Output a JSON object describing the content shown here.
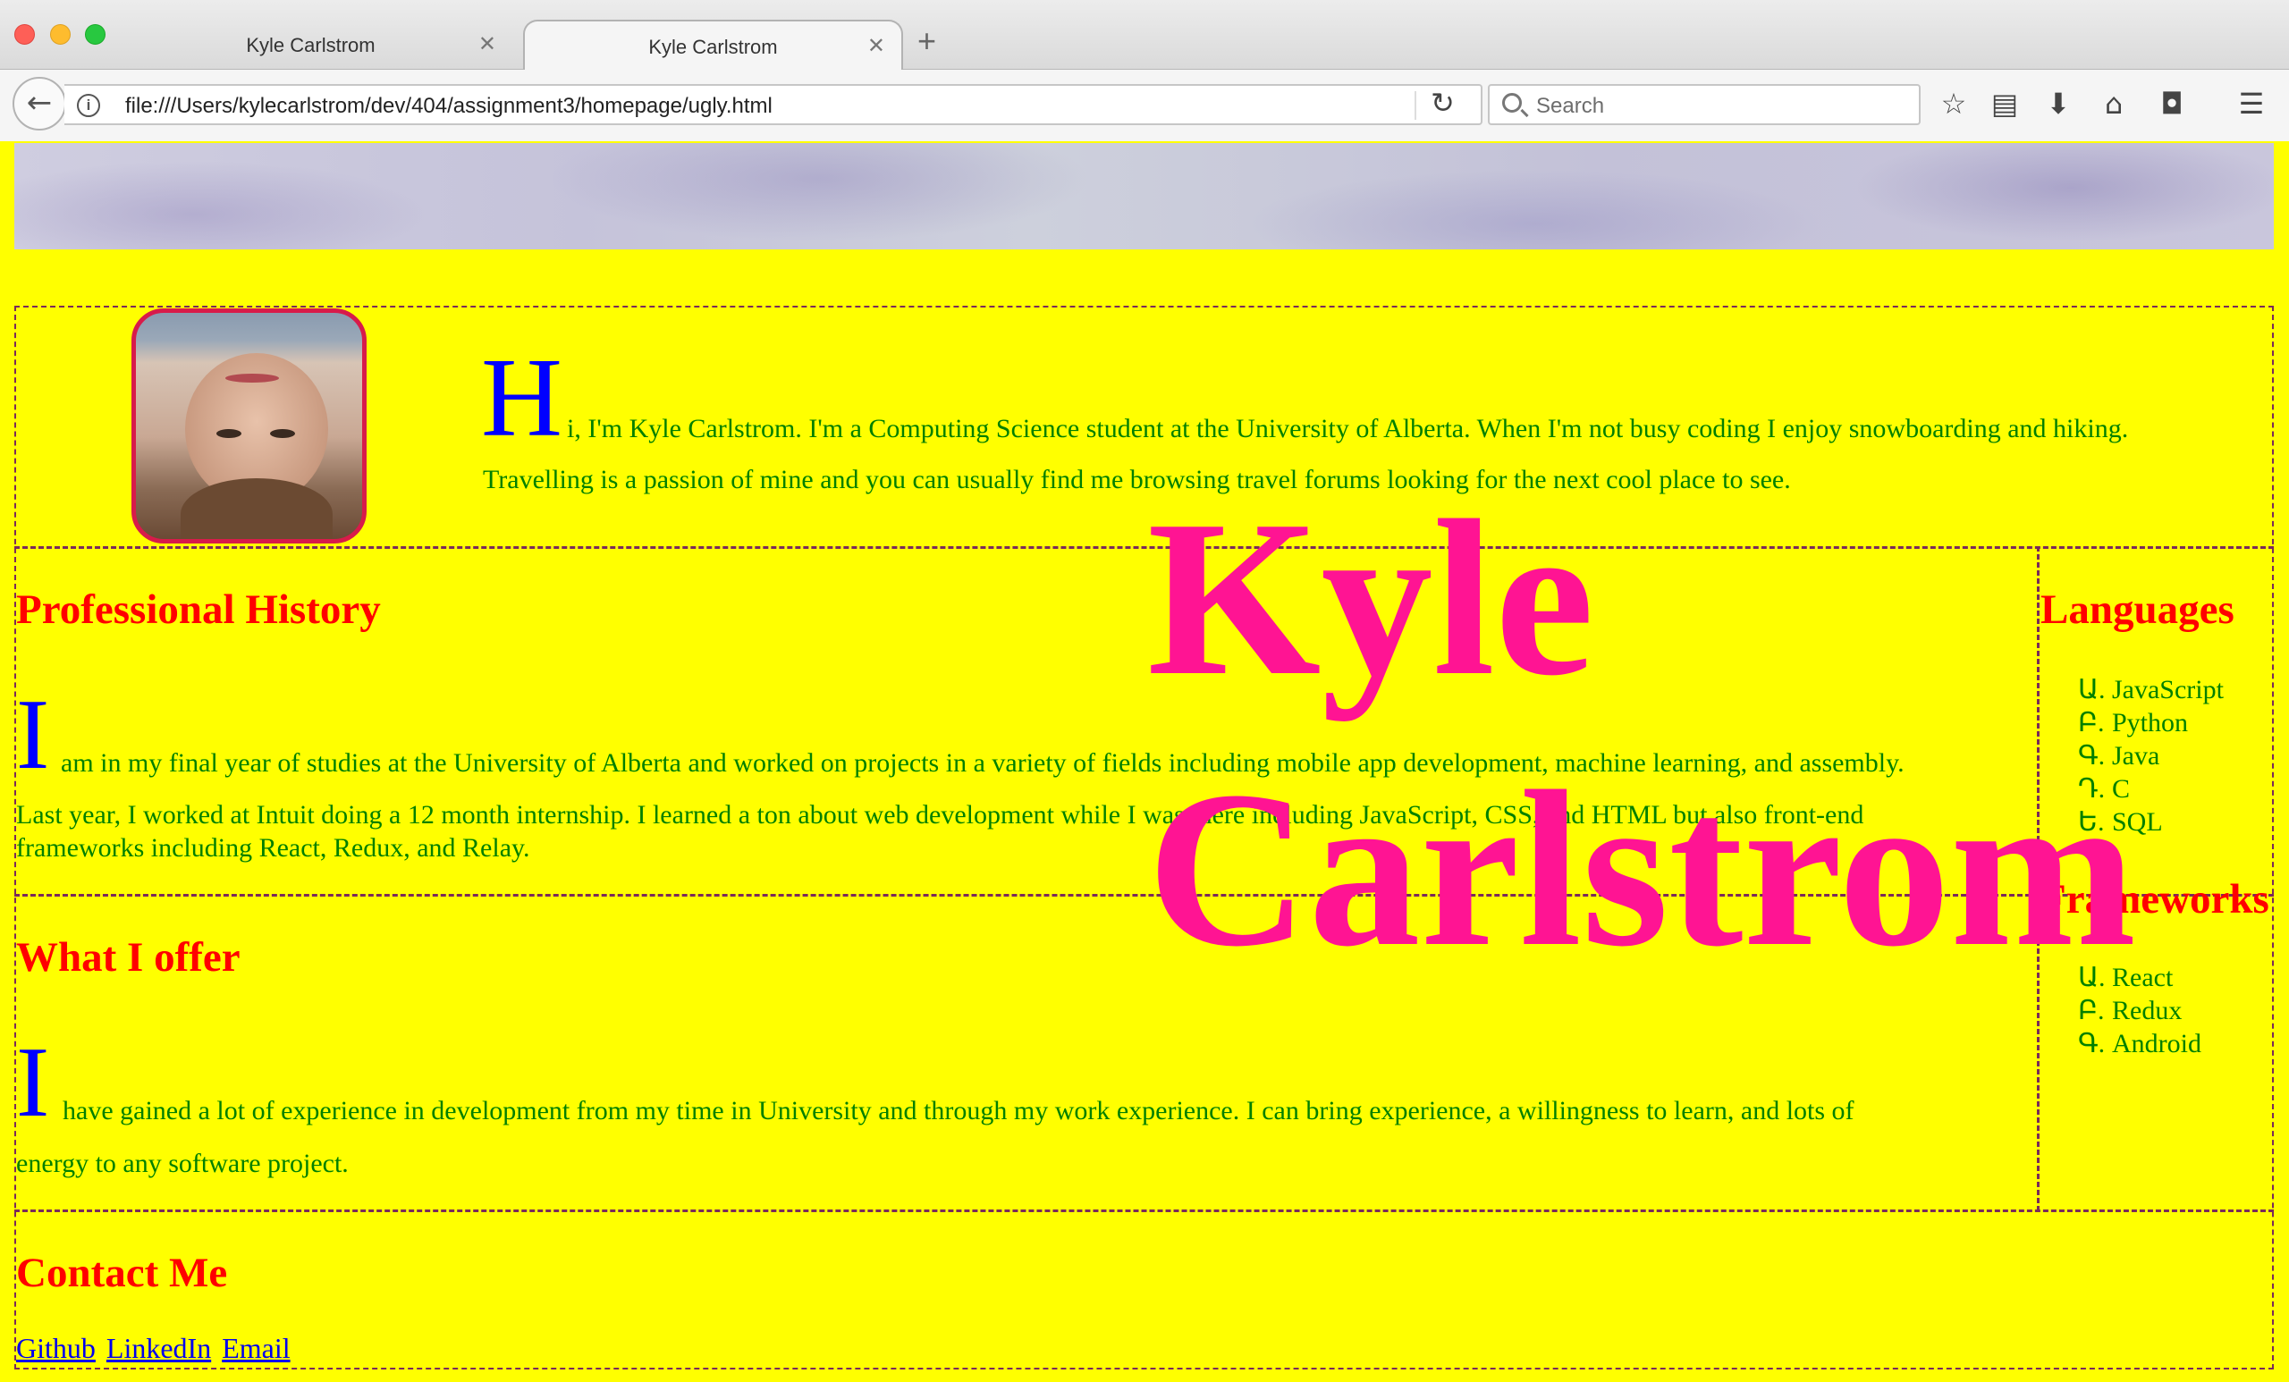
{
  "browser": {
    "tabs": [
      {
        "title": "Kyle Carlstrom",
        "active": false
      },
      {
        "title": "Kyle Carlstrom",
        "active": true
      }
    ],
    "url": "file:///Users/kylecarlstrom/dev/404/assignment3/homepage/ugly.html",
    "search_placeholder": "Search",
    "icons": [
      "back-arrow-icon",
      "info-icon",
      "reload-icon",
      "search-icon",
      "bookmark-star-icon",
      "reading-list-icon",
      "download-icon",
      "home-icon",
      "pocket-icon",
      "menu-icon"
    ]
  },
  "page": {
    "colors": {
      "background": "#ffff00",
      "heading": "#ff0000",
      "text": "#008000",
      "dropcap": "#0000ff",
      "name": "#ff1493",
      "link": "#0000ee"
    },
    "name_line1": "Kyle",
    "name_line2": "Carlstrom",
    "intro": {
      "dropcap": "H",
      "line1": "i, I'm Kyle Carlstrom. I'm a Computing Science student at the University of Alberta. When I'm not busy coding I enjoy snowboarding and hiking.",
      "line2": "Travelling is a passion of mine and you can usually find me browsing travel forums looking for the next cool place to see."
    },
    "professional_history": {
      "heading": "Professional History",
      "dropcap": "I",
      "line1": "am in my final year of studies at the University of Alberta and worked on projects in a variety of fields including mobile app development, machine learning, and assembly.",
      "line2": "Last year, I worked at Intuit doing a 12 month internship. I learned a ton about web development while I was there including JavaScript, CSS, and HTML but also front-end",
      "line3": "frameworks including React, Redux, and Relay."
    },
    "what_i_offer": {
      "heading": "What I offer",
      "dropcap": "I",
      "line1": "have gained a lot of experience in development from my time in University and through my work experience. I can bring experience, a willingness to learn, and lots of",
      "line2": "energy to any software project."
    },
    "languages": {
      "heading": "Languages",
      "items": [
        {
          "marker": "Ա.",
          "label": "JavaScript"
        },
        {
          "marker": "Բ.",
          "label": "Python"
        },
        {
          "marker": "Գ.",
          "label": "Java"
        },
        {
          "marker": "Դ.",
          "label": "C"
        },
        {
          "marker": "Ե.",
          "label": "SQL"
        }
      ]
    },
    "frameworks": {
      "heading": "Frameworks",
      "items": [
        {
          "marker": "Ա.",
          "label": "React"
        },
        {
          "marker": "Բ.",
          "label": "Redux"
        },
        {
          "marker": "Գ.",
          "label": "Android"
        }
      ]
    },
    "contact": {
      "heading": "Contact Me",
      "links": [
        "Github",
        "LinkedIn",
        "Email"
      ]
    }
  }
}
